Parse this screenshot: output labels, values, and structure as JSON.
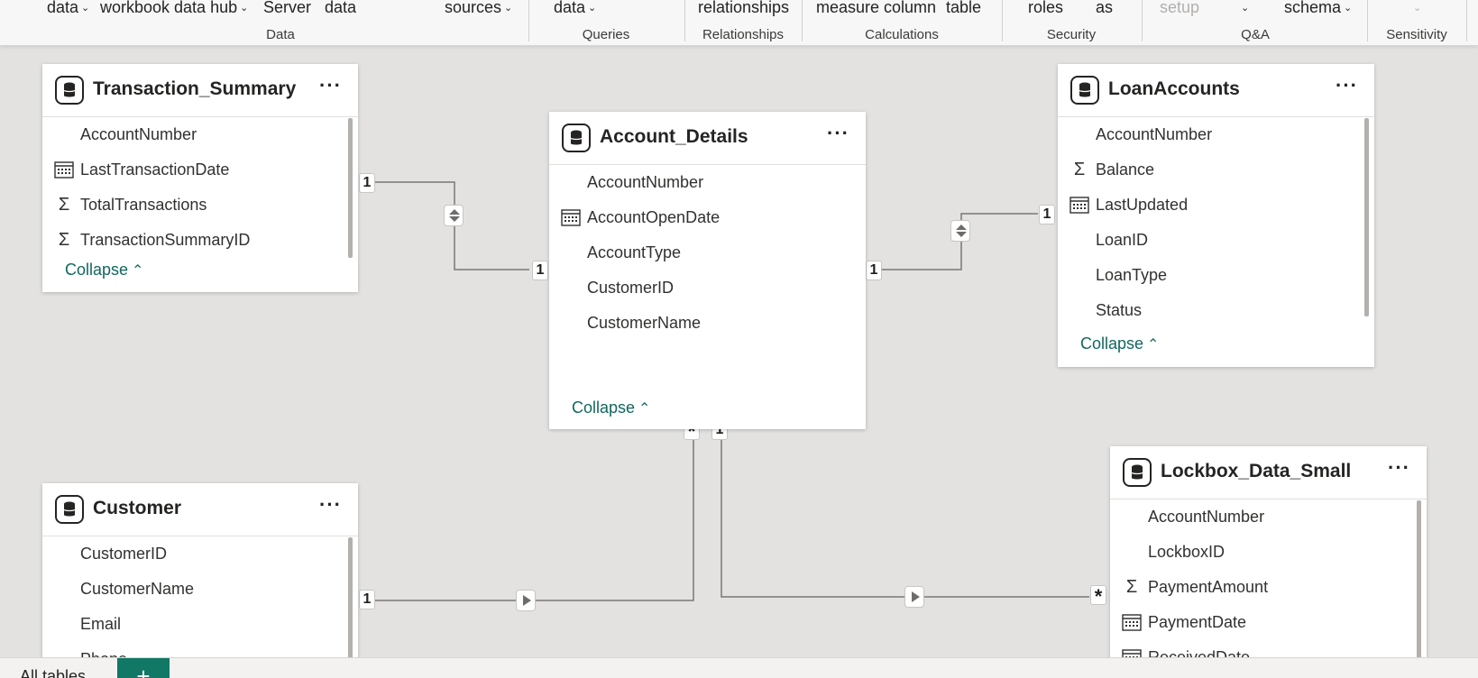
{
  "ribbon": {
    "items": {
      "get_data": "data",
      "workbook_data_hub": "workbook data hub",
      "server": "Server",
      "enter_data": "data",
      "recent_sources": "sources",
      "transform_data": "data",
      "relationships": "relationships",
      "measure_column": "measure column",
      "table": "table",
      "roles": "roles",
      "view_as": "as",
      "qa_setup": "setup",
      "schema": "schema"
    },
    "groups": {
      "data": "Data",
      "queries": "Queries",
      "relationships": "Relationships",
      "calculations": "Calculations",
      "security": "Security",
      "qa": "Q&A",
      "sensitivity": "Sensitivity"
    }
  },
  "tables": {
    "transaction_summary": {
      "name": "Transaction_Summary",
      "fields": [
        "AccountNumber",
        "LastTransactionDate",
        "TotalTransactions",
        "TransactionSummaryID"
      ],
      "field_icons": [
        "none",
        "calendar-icon",
        "sigma-icon",
        "sigma-icon"
      ],
      "collapse": "Collapse"
    },
    "account_details": {
      "name": "Account_Details",
      "fields": [
        "AccountNumber",
        "AccountOpenDate",
        "AccountType",
        "CustomerID",
        "CustomerName"
      ],
      "field_icons": [
        "none",
        "calendar-icon",
        "none",
        "none",
        "none"
      ],
      "collapse": "Collapse"
    },
    "loan_accounts": {
      "name": "LoanAccounts",
      "fields": [
        "AccountNumber",
        "Balance",
        "LastUpdated",
        "LoanID",
        "LoanType",
        "Status"
      ],
      "field_icons": [
        "none",
        "sigma-icon",
        "calendar-icon",
        "none",
        "none",
        "none"
      ],
      "collapse": "Collapse"
    },
    "customer": {
      "name": "Customer",
      "fields": [
        "CustomerID",
        "CustomerName",
        "Email",
        "Phone"
      ],
      "field_icons": [
        "none",
        "none",
        "none",
        "none"
      ]
    },
    "lockbox_data_small": {
      "name": "Lockbox_Data_Small",
      "fields": [
        "AccountNumber",
        "LockboxID",
        "PaymentAmount",
        "PaymentDate",
        "ReceivedDate"
      ],
      "field_icons": [
        "none",
        "none",
        "sigma-icon",
        "calendar-icon",
        "calendar-icon"
      ]
    }
  },
  "relationships": {
    "one": "1",
    "many": "*"
  },
  "bottom_tabs": {
    "all_tables": "All tables",
    "add": "+"
  },
  "colors": {
    "canvas": "#e3e2e1",
    "accent": "#117865",
    "collapse_link": "#11675e"
  }
}
